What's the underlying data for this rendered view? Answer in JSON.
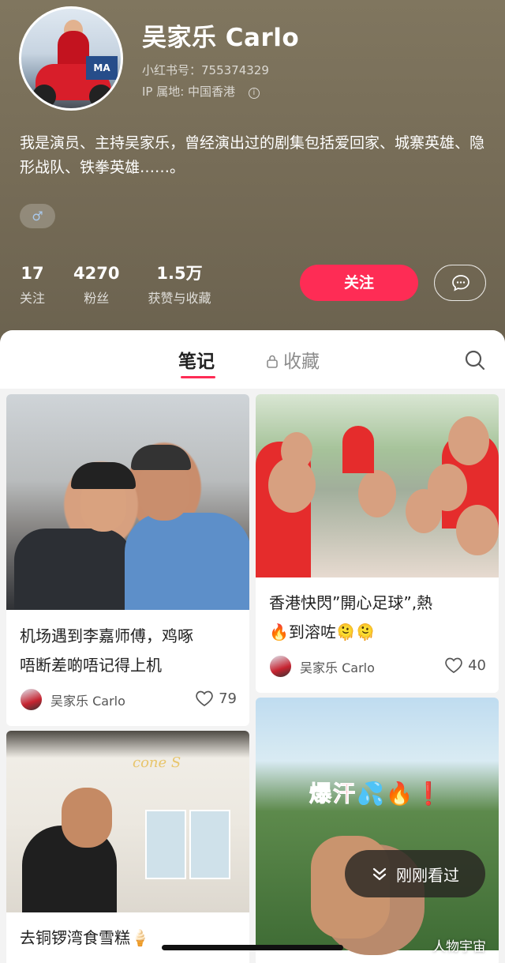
{
  "profile": {
    "name": "吴家乐 Carlo",
    "red_id": "小红书号：755374329",
    "ip_location": "IP 属地: 中国香港",
    "info_icon": "ⓘ",
    "bio": "我是演员、主持吴家乐，曾经演出过的剧集包括爱回家、城寨英雄、隐形战队、铁拳英雄……。",
    "gender_icon": "♂",
    "avatar_sign_text": "MA",
    "stats": [
      {
        "value": "17",
        "label": "关注"
      },
      {
        "value": "4270",
        "label": "粉丝"
      },
      {
        "value": "1.5万",
        "label": "获赞与收藏"
      }
    ],
    "follow_label": "关注",
    "chat_icon": "chat-bubble-icon"
  },
  "tabs": {
    "notes": "笔记",
    "collections": "收藏",
    "search_icon": "search-icon"
  },
  "notes": [
    {
      "title_line1": "机场遇到李嘉师傅，鸡啄",
      "title_line2": "唔断差啲唔记得上机",
      "author": "吴家乐 Carlo",
      "likes": "79"
    },
    {
      "title_line1": "香港快閃”開心足球”,熱",
      "title_line2": "🔥到溶咗🫠🫠",
      "author": "吴家乐 Carlo",
      "likes": "40"
    },
    {
      "title_line1": "去铜锣湾食雪糕🍦",
      "photo_sign": "cone S"
    },
    {
      "photo_text": "爆汗💦🔥❗"
    }
  ],
  "recent_pill": {
    "label": "刚刚看过",
    "icon": "chevron-double-down-icon"
  },
  "watermark": "人物宇宙",
  "colors": {
    "header_bg": "#7a705a",
    "accent": "#fe2c55",
    "panel_bg": "#f3f3f3"
  }
}
